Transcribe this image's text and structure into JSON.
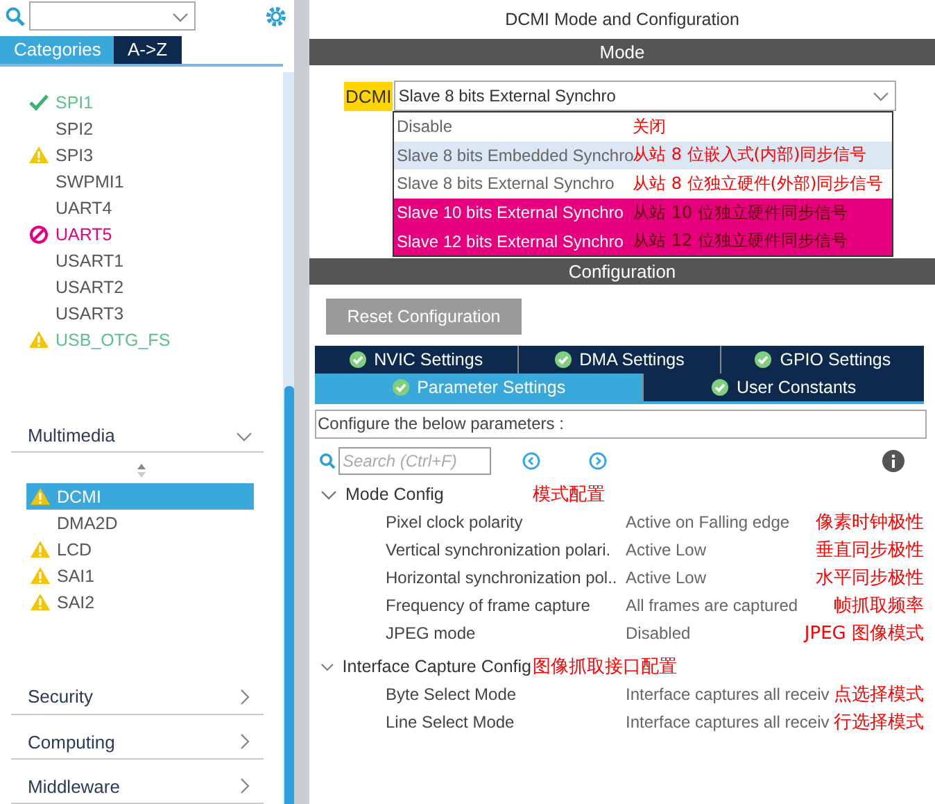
{
  "sidebar": {
    "tabs": [
      {
        "label": "Categories",
        "selected": true
      },
      {
        "label": "A->Z",
        "selected": false
      }
    ],
    "peripherals": [
      {
        "label": "SPI1",
        "kind": "ok"
      },
      {
        "label": "SPI2",
        "kind": "plain"
      },
      {
        "label": "SPI3",
        "kind": "warning"
      },
      {
        "label": "SWPMI1",
        "kind": "plain"
      },
      {
        "label": "UART4",
        "kind": "plain"
      },
      {
        "label": "UART5",
        "kind": "error"
      },
      {
        "label": "USART1",
        "kind": "plain"
      },
      {
        "label": "USART2",
        "kind": "plain"
      },
      {
        "label": "USART3",
        "kind": "plain"
      },
      {
        "label": "USB_OTG_FS",
        "kind": "warning"
      }
    ],
    "categories": [
      {
        "label": "Multimedia",
        "expanded": true,
        "items": [
          {
            "label": "DCMI",
            "kind": "warning",
            "selected": true
          },
          {
            "label": "DMA2D",
            "kind": "plain",
            "selected": false
          },
          {
            "label": "LCD",
            "kind": "warning",
            "selected": false
          },
          {
            "label": "SAI1",
            "kind": "warning",
            "selected": false
          },
          {
            "label": "SAI2",
            "kind": "warning",
            "selected": false
          }
        ]
      },
      {
        "label": "Security",
        "expanded": false
      },
      {
        "label": "Computing",
        "expanded": false
      },
      {
        "label": "Middleware",
        "expanded": false
      }
    ]
  },
  "main": {
    "title": "DCMI Mode and Configuration",
    "mode_header": "Mode",
    "mode_label": "DCMI",
    "mode_select": {
      "value": "Slave 8 bits External Synchro",
      "expanded": true,
      "options": [
        {
          "label": "Disable",
          "kind": "normal",
          "annotation": "关闭"
        },
        {
          "label": "Slave 8 bits Embedded Synchro",
          "kind": "hover",
          "annotation": "从站 8 位嵌入式(内部)同步信号"
        },
        {
          "label": "Slave 8 bits External Synchro",
          "kind": "normal",
          "annotation": "从站 8 位独立硬件(外部)同步信号"
        },
        {
          "label": "Slave 10 bits External Synchro",
          "kind": "conflict",
          "annotation": "从站 10 位独立硬件同步信号"
        },
        {
          "label": "Slave 12 bits External Synchro",
          "kind": "conflict",
          "annotation": "从站 12 位独立硬件同步信号"
        }
      ]
    },
    "config_header": "Configuration",
    "reset_button": "Reset Configuration",
    "tab_rows": [
      [
        {
          "label": "NVIC Settings",
          "selected": false
        },
        {
          "label": "DMA Settings",
          "selected": false
        },
        {
          "label": "GPIO Settings",
          "selected": false
        }
      ],
      [
        {
          "label": "Parameter Settings",
          "selected": true
        },
        {
          "label": "User Constants",
          "selected": false
        }
      ]
    ],
    "caption": "Configure the below parameters :",
    "search": {
      "placeholder": "Search (Ctrl+F)"
    },
    "groups": [
      {
        "label": "Mode Config",
        "expanded": true,
        "annotation": "模式配置",
        "params": [
          {
            "name": "Pixel clock polarity",
            "value": "Active on Falling edge",
            "annotation": "像素时钟极性"
          },
          {
            "name": "Vertical synchronization polari.",
            "value": "Active Low",
            "annotation": "垂直同步极性"
          },
          {
            "name": "Horizontal synchronization pol..",
            "value": "Active Low",
            "annotation": "水平同步极性"
          },
          {
            "name": "Frequency of frame capture",
            "value": "All frames are captured",
            "annotation": "帧抓取频率"
          },
          {
            "name": "JPEG mode",
            "value": "Disabled",
            "annotation": "JPEG 图像模式"
          }
        ]
      },
      {
        "label": "Interface Capture Config",
        "expanded": true,
        "annotation": "图像抓取接口配置",
        "params": [
          {
            "name": "Byte Select Mode",
            "value": "Interface captures all receiv",
            "annotation": "点选择模式"
          },
          {
            "name": "Line Select Mode",
            "value": "Interface captures all receiv",
            "annotation": "行选择模式"
          }
        ]
      }
    ]
  }
}
